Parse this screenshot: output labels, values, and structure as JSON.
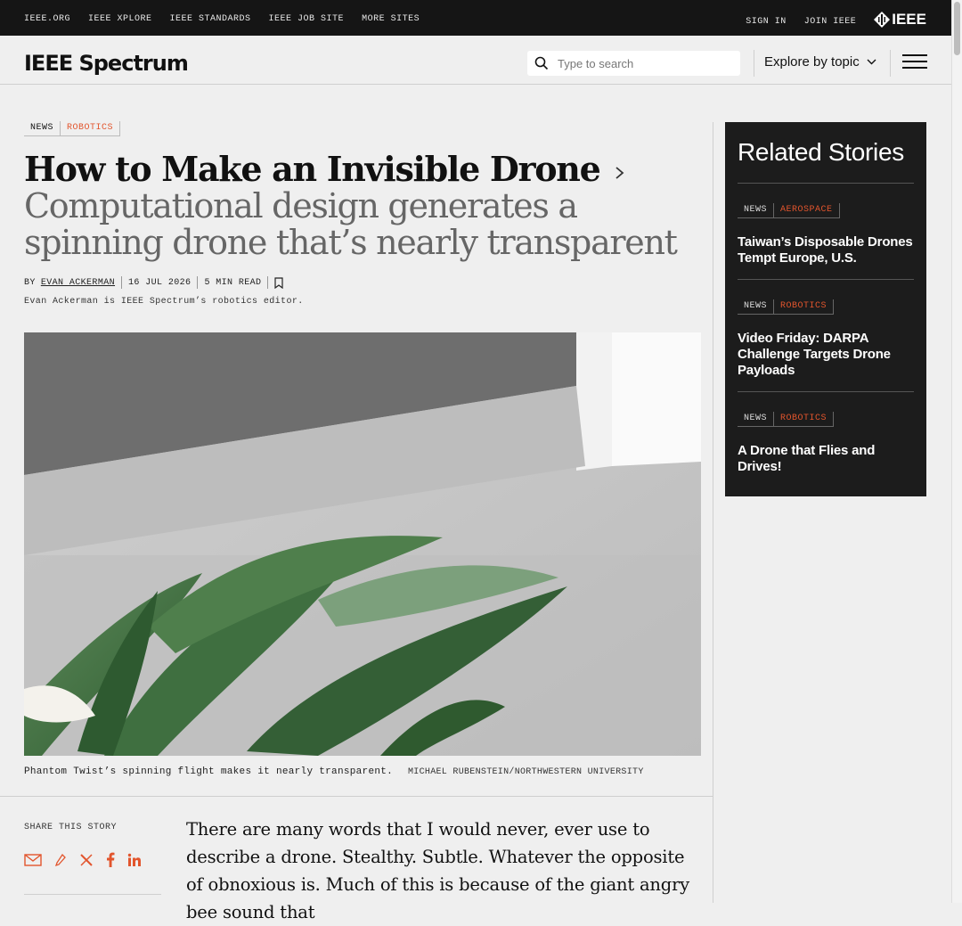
{
  "topbar": {
    "links": [
      "IEEE.ORG",
      "IEEE XPLORE",
      "IEEE STANDARDS",
      "IEEE JOB SITE",
      "MORE SITES"
    ],
    "sign_in": "SIGN IN",
    "join": "JOIN IEEE",
    "logo_text": "IEEE"
  },
  "header": {
    "brand": "IEEE Spectrum",
    "search_placeholder": "Type to search",
    "explore_label": "Explore by topic"
  },
  "article": {
    "tags": [
      "NEWS",
      "ROBOTICS"
    ],
    "title": "How to Make an Invisible Drone",
    "subtitle": "Computational design generates a spinning drone that’s nearly transparent",
    "by": "BY",
    "author": "EVAN ACKERMAN",
    "date": "16 JUL 2026",
    "read_time": "5 MIN READ",
    "author_bio": "Evan Ackerman is IEEE Spectrum’s robotics editor.",
    "caption": "Phantom Twist’s spinning flight makes it nearly transparent.",
    "credit": "MICHAEL RUBENSTEIN/NORTHWESTERN UNIVERSITY",
    "share_label": "SHARE THIS STORY",
    "body": "There are many words that I would never, ever use to describe a drone. Stealthy. Subtle. Whatever the opposite of obnoxious is. Much of this is because of the giant angry bee sound that"
  },
  "related": {
    "heading": "Related Stories",
    "stories": [
      {
        "tag1": "NEWS",
        "tag2": "AEROSPACE",
        "title": "Taiwan’s Disposable Drones Tempt Europe, U.S."
      },
      {
        "tag1": "NEWS",
        "tag2": "ROBOTICS",
        "title": "Video Friday: DARPA Challenge Targets Drone Payloads"
      },
      {
        "tag1": "NEWS",
        "tag2": "ROBOTICS",
        "title": "A Drone that Flies and Drives!"
      }
    ]
  },
  "colors": {
    "accent": "#e2552d",
    "topbar": "#151515",
    "related_bg": "#1c1c1c"
  }
}
